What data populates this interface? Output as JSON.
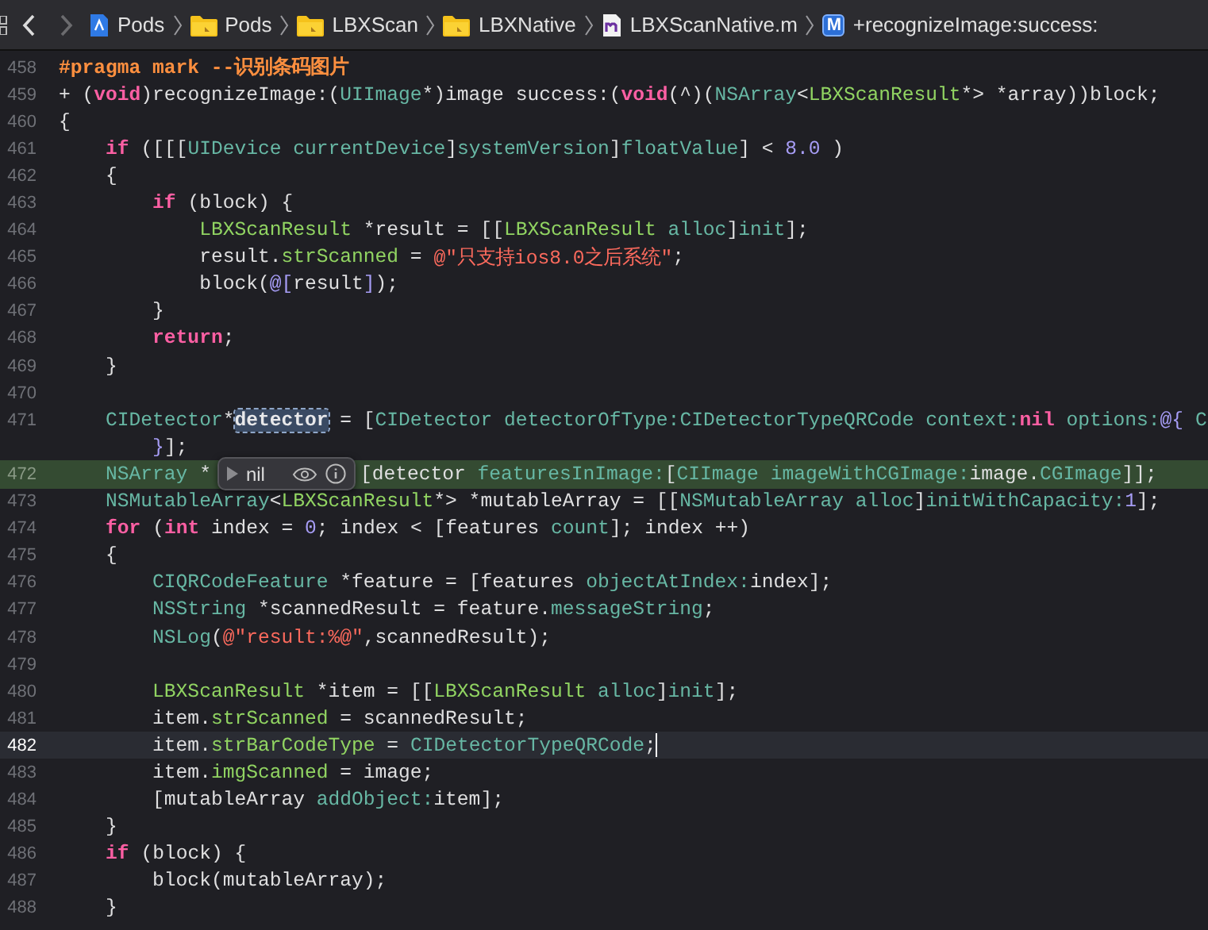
{
  "navigation": {
    "back_enabled": true,
    "forward_enabled": false
  },
  "breadcrumb": [
    {
      "kind": "project",
      "label": "Pods"
    },
    {
      "kind": "group",
      "label": "Pods"
    },
    {
      "kind": "group",
      "label": "LBXScan"
    },
    {
      "kind": "group",
      "label": "LBXNative"
    },
    {
      "kind": "file",
      "label": "LBXScanNative.m"
    },
    {
      "kind": "method",
      "label": "+recognizeImage:success:",
      "badge": "M"
    }
  ],
  "editor": {
    "lines": [
      {
        "number": "458",
        "current": false,
        "highlighted": false,
        "tokens": [
          {
            "kind": "preproc",
            "text": "#pragma mark --识别条码图片"
          }
        ]
      },
      {
        "number": "459",
        "current": false,
        "highlighted": false,
        "tokens": [
          {
            "kind": "plain",
            "text": "+ ("
          },
          {
            "kind": "keyword",
            "text": "void"
          },
          {
            "kind": "plain",
            "text": ")recognizeImage:("
          },
          {
            "kind": "system",
            "text": "UIImage"
          },
          {
            "kind": "plain",
            "text": "*)image success:("
          },
          {
            "kind": "keyword",
            "text": "void"
          },
          {
            "kind": "plain",
            "text": "(^)("
          },
          {
            "kind": "system",
            "text": "NSArray"
          },
          {
            "kind": "plain",
            "text": "<"
          },
          {
            "kind": "project",
            "text": "LBXScanResult"
          },
          {
            "kind": "plain",
            "text": "*> *array))block;"
          }
        ]
      },
      {
        "number": "460",
        "current": false,
        "highlighted": false,
        "tokens": [
          {
            "kind": "plain",
            "text": "{"
          }
        ]
      },
      {
        "number": "461",
        "current": false,
        "highlighted": false,
        "tokens": [
          {
            "kind": "keyword",
            "text": "    if"
          },
          {
            "kind": "plain",
            "text": " ([[["
          },
          {
            "kind": "system",
            "text": "UIDevice "
          },
          {
            "kind": "system",
            "text": "currentDevice"
          },
          {
            "kind": "plain",
            "text": "]"
          },
          {
            "kind": "system",
            "text": "systemVersion"
          },
          {
            "kind": "plain",
            "text": "]"
          },
          {
            "kind": "system",
            "text": "floatValue"
          },
          {
            "kind": "plain",
            "text": "] < "
          },
          {
            "kind": "number",
            "text": "8.0"
          },
          {
            "kind": "plain",
            "text": " )"
          }
        ]
      },
      {
        "number": "462",
        "current": false,
        "highlighted": false,
        "tokens": [
          {
            "kind": "plain",
            "text": "    {"
          }
        ]
      },
      {
        "number": "463",
        "current": false,
        "highlighted": false,
        "tokens": [
          {
            "kind": "keyword",
            "text": "        if"
          },
          {
            "kind": "plain",
            "text": " (block) {"
          }
        ]
      },
      {
        "number": "464",
        "current": false,
        "highlighted": false,
        "tokens": [
          {
            "kind": "project",
            "text": "            LBXScanResult"
          },
          {
            "kind": "plain",
            "text": " *result = [["
          },
          {
            "kind": "project",
            "text": "LBXScanResult "
          },
          {
            "kind": "system",
            "text": "alloc"
          },
          {
            "kind": "plain",
            "text": "]"
          },
          {
            "kind": "system",
            "text": "init"
          },
          {
            "kind": "plain",
            "text": "];"
          }
        ]
      },
      {
        "number": "465",
        "current": false,
        "highlighted": false,
        "tokens": [
          {
            "kind": "plain",
            "text": "            result."
          },
          {
            "kind": "project",
            "text": "strScanned"
          },
          {
            "kind": "plain",
            "text": " = "
          },
          {
            "kind": "string",
            "text": "@\"只支持ios8.0之后系统\""
          },
          {
            "kind": "plain",
            "text": ";"
          }
        ]
      },
      {
        "number": "466",
        "current": false,
        "highlighted": false,
        "tokens": [
          {
            "kind": "plain",
            "text": "            block("
          },
          {
            "kind": "literal",
            "text": "@["
          },
          {
            "kind": "plain",
            "text": "result"
          },
          {
            "kind": "literal",
            "text": "]"
          },
          {
            "kind": "plain",
            "text": ");"
          }
        ]
      },
      {
        "number": "467",
        "current": false,
        "highlighted": false,
        "tokens": [
          {
            "kind": "plain",
            "text": "        }"
          }
        ]
      },
      {
        "number": "468",
        "current": false,
        "highlighted": false,
        "tokens": [
          {
            "kind": "keyword",
            "text": "        return"
          },
          {
            "kind": "plain",
            "text": ";"
          }
        ]
      },
      {
        "number": "469",
        "current": false,
        "highlighted": false,
        "tokens": [
          {
            "kind": "plain",
            "text": "    }"
          }
        ]
      },
      {
        "number": "470",
        "current": false,
        "highlighted": false
      },
      {
        "number": "471",
        "current": false,
        "highlighted": false,
        "tokens": [
          {
            "kind": "system",
            "text": "    CIDetector"
          },
          {
            "kind": "plain",
            "text": "*"
          },
          {
            "kind": "match",
            "text": "detector"
          },
          {
            "kind": "plain",
            "text": " = ["
          },
          {
            "kind": "system",
            "text": "CIDetector "
          },
          {
            "kind": "system",
            "text": "detectorOfType:"
          },
          {
            "kind": "system",
            "text": "CIDetectorTypeQRCode "
          },
          {
            "kind": "system",
            "text": "context:"
          },
          {
            "kind": "keyword",
            "text": "nil "
          },
          {
            "kind": "system",
            "text": "options:"
          },
          {
            "kind": "literal",
            "text": "@{ "
          },
          {
            "kind": "system",
            "text": "C"
          }
        ],
        "wrap_tokens": [
          {
            "kind": "literal",
            "text": "        }"
          },
          {
            "kind": "plain",
            "text": "];"
          }
        ]
      },
      {
        "number": "472",
        "current": false,
        "highlighted": true,
        "tokens": [
          {
            "kind": "system",
            "text": "    NSArray"
          },
          {
            "kind": "plain",
            "text": " *"
          }
        ],
        "popover": {
          "value": "nil"
        },
        "tokens_after": [
          {
            "kind": "plain",
            "text": "[detector "
          },
          {
            "kind": "system",
            "text": "featuresInImage:"
          },
          {
            "kind": "plain",
            "text": "["
          },
          {
            "kind": "system",
            "text": "CIImage "
          },
          {
            "kind": "system",
            "text": "imageWithCGImage:"
          },
          {
            "kind": "plain",
            "text": "image."
          },
          {
            "kind": "system",
            "text": "CGImage"
          },
          {
            "kind": "plain",
            "text": "]];"
          }
        ]
      },
      {
        "number": "473",
        "current": false,
        "highlighted": false,
        "tokens": [
          {
            "kind": "system",
            "text": "    NSMutableArray"
          },
          {
            "kind": "plain",
            "text": "<"
          },
          {
            "kind": "project",
            "text": "LBXScanResult"
          },
          {
            "kind": "plain",
            "text": "*> *mutableArray = [["
          },
          {
            "kind": "system",
            "text": "NSMutableArray "
          },
          {
            "kind": "system",
            "text": "alloc"
          },
          {
            "kind": "plain",
            "text": "]"
          },
          {
            "kind": "system",
            "text": "initWithCapacity:"
          },
          {
            "kind": "number",
            "text": "1"
          },
          {
            "kind": "plain",
            "text": "];"
          }
        ]
      },
      {
        "number": "474",
        "current": false,
        "highlighted": false,
        "tokens": [
          {
            "kind": "keyword",
            "text": "    for"
          },
          {
            "kind": "plain",
            "text": " ("
          },
          {
            "kind": "keyword",
            "text": "int"
          },
          {
            "kind": "plain",
            "text": " index = "
          },
          {
            "kind": "number",
            "text": "0"
          },
          {
            "kind": "plain",
            "text": "; index < [features "
          },
          {
            "kind": "system",
            "text": "count"
          },
          {
            "kind": "plain",
            "text": "]; index ++)"
          }
        ]
      },
      {
        "number": "475",
        "current": false,
        "highlighted": false,
        "tokens": [
          {
            "kind": "plain",
            "text": "    {"
          }
        ]
      },
      {
        "number": "476",
        "current": false,
        "highlighted": false,
        "tokens": [
          {
            "kind": "system",
            "text": "        CIQRCodeFeature"
          },
          {
            "kind": "plain",
            "text": " *feature = [features "
          },
          {
            "kind": "system",
            "text": "objectAtIndex:"
          },
          {
            "kind": "plain",
            "text": "index];"
          }
        ]
      },
      {
        "number": "477",
        "current": false,
        "highlighted": false,
        "tokens": [
          {
            "kind": "system",
            "text": "        NSString"
          },
          {
            "kind": "plain",
            "text": " *scannedResult = feature."
          },
          {
            "kind": "system",
            "text": "messageString"
          },
          {
            "kind": "plain",
            "text": ";"
          }
        ]
      },
      {
        "number": "478",
        "current": false,
        "highlighted": false,
        "tokens": [
          {
            "kind": "system",
            "text": "        NSLog"
          },
          {
            "kind": "plain",
            "text": "("
          },
          {
            "kind": "string",
            "text": "@\"result:%@\""
          },
          {
            "kind": "plain",
            "text": ",scannedResult);"
          }
        ]
      },
      {
        "number": "479",
        "current": false,
        "highlighted": false
      },
      {
        "number": "480",
        "current": false,
        "highlighted": false,
        "tokens": [
          {
            "kind": "project",
            "text": "        LBXScanResult"
          },
          {
            "kind": "plain",
            "text": " *item = [["
          },
          {
            "kind": "project",
            "text": "LBXScanResult "
          },
          {
            "kind": "system",
            "text": "alloc"
          },
          {
            "kind": "plain",
            "text": "]"
          },
          {
            "kind": "system",
            "text": "init"
          },
          {
            "kind": "plain",
            "text": "];"
          }
        ]
      },
      {
        "number": "481",
        "current": false,
        "highlighted": false,
        "tokens": [
          {
            "kind": "plain",
            "text": "        item."
          },
          {
            "kind": "project",
            "text": "strScanned"
          },
          {
            "kind": "plain",
            "text": " = scannedResult;"
          }
        ]
      },
      {
        "number": "482",
        "current": true,
        "highlighted": false,
        "tokens": [
          {
            "kind": "plain",
            "text": "        item."
          },
          {
            "kind": "project",
            "text": "strBarCodeType"
          },
          {
            "kind": "plain",
            "text": " = "
          },
          {
            "kind": "system",
            "text": "CIDetectorTypeQRCode"
          },
          {
            "kind": "plain",
            "text": ";"
          }
        ]
      },
      {
        "number": "483",
        "current": false,
        "highlighted": false,
        "tokens": [
          {
            "kind": "plain",
            "text": "        item."
          },
          {
            "kind": "project",
            "text": "imgScanned"
          },
          {
            "kind": "plain",
            "text": " = image;"
          }
        ]
      },
      {
        "number": "484",
        "current": false,
        "highlighted": false,
        "tokens": [
          {
            "kind": "plain",
            "text": "        [mutableArray "
          },
          {
            "kind": "system",
            "text": "addObject:"
          },
          {
            "kind": "plain",
            "text": "item];"
          }
        ]
      },
      {
        "number": "485",
        "current": false,
        "highlighted": false,
        "tokens": [
          {
            "kind": "plain",
            "text": "    }"
          }
        ]
      },
      {
        "number": "486",
        "current": false,
        "highlighted": false,
        "tokens": [
          {
            "kind": "keyword",
            "text": "    if"
          },
          {
            "kind": "plain",
            "text": " (block) {"
          }
        ]
      },
      {
        "number": "487",
        "current": false,
        "highlighted": false,
        "tokens": [
          {
            "kind": "plain",
            "text": "        block(mutableArray);"
          }
        ]
      },
      {
        "number": "488",
        "current": false,
        "highlighted": false,
        "tokens": [
          {
            "kind": "plain",
            "text": "    }"
          }
        ]
      }
    ]
  }
}
